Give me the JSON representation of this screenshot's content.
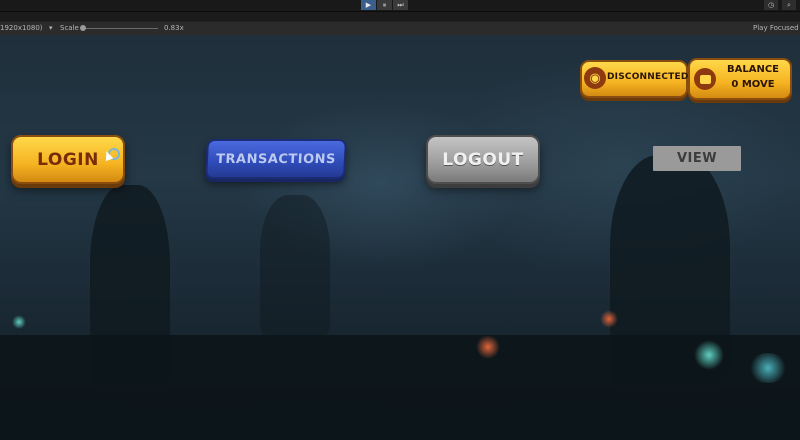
{
  "editor": {
    "play_icon": "▶",
    "pause_icon": "⏸",
    "step_icon": "⏭",
    "history_icon": "history-icon",
    "search_icon": "search-icon",
    "resolution": "1920x1080)",
    "scale_label": "Scale",
    "scale_value": "0.83x",
    "play_focused": "Play Focused"
  },
  "game": {
    "login_label": "LOGIN",
    "transactions_label": "TRANSACTIONS",
    "logout_label": "LOGOUT",
    "view_label": "VIEW",
    "connection_status": "DISCONNECTED",
    "balance_title": "BALANCE",
    "balance_value": "0 MOVE"
  },
  "colors": {
    "gold": "#f5b321",
    "blue": "#2f4bb8",
    "grey": "#9c9c9c",
    "brown": "#8e3a10",
    "play_active": "#3b5f8c"
  }
}
